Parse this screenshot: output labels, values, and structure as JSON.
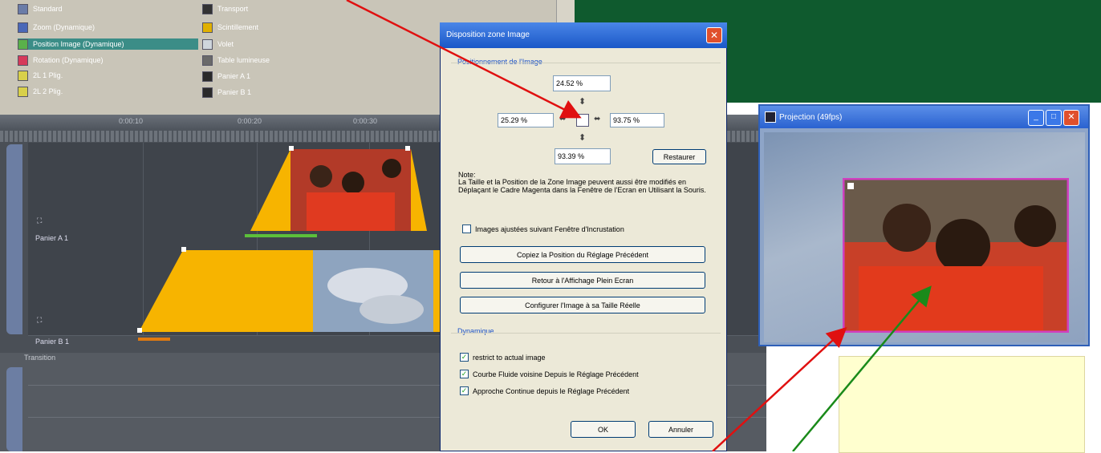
{
  "effects": {
    "left_column": [
      {
        "label": "Standard",
        "icon": "standard-icon"
      },
      {
        "label": "Zoom (Dynamique)",
        "icon": "zoom-icon"
      },
      {
        "label": "Position Image (Dynamique)",
        "icon": "position-image-icon",
        "selected": true
      },
      {
        "label": "Rotation (Dynamique)",
        "icon": "rotation-icon"
      },
      {
        "label": "2L 1 Plig.",
        "icon": "fold-icon"
      },
      {
        "label": "2L 2 Plig.",
        "icon": "fold-icon"
      }
    ],
    "right_column": [
      {
        "label": "Transport",
        "icon": "transport-icon"
      },
      {
        "label": "Scintillement",
        "icon": "flicker-icon"
      },
      {
        "label": "Volet",
        "icon": "wipe-icon"
      },
      {
        "label": "Table lumineuse",
        "icon": "lightbox-icon"
      },
      {
        "label": "Panier A 1",
        "icon": "basket-icon"
      },
      {
        "label": "Panier B 1",
        "icon": "basket-icon"
      }
    ]
  },
  "timeline": {
    "ruler_labels": [
      "0:00:10",
      "0:00:20",
      "0:00:30"
    ],
    "track_a_label": "Panier A 1",
    "track_b_label": "Panier B 1",
    "lower_label": "Transition"
  },
  "dialog": {
    "title": "Disposition zone Image",
    "group_position": "Positionnement de l'Image",
    "top_value": "24.52 %",
    "left_value": "25.29 %",
    "right_value": "93.75 %",
    "bottom_value": "93.39 %",
    "restore_button": "Restaurer",
    "note_title": "Note:",
    "note_text": "La Taille et la Position de la Zone Image peuvent aussi être modifiés en Déplaçant le Cadre Magenta dans la Fenêtre de l'Ecran en Utilisant la Souris.",
    "checkbox_follow": "Images ajustées suivant Fenêtre d'Incrustation",
    "copy_button": "Copiez la Position du Réglage Précédent",
    "fullscreen_button": "Retour à l'Affichage Plein Ecran",
    "realsize_button": "Configurer l'Image à sa Taille Réelle",
    "group_dynamic": "Dynamique",
    "dyn_restrict": "restrict to actual image",
    "dyn_curve": "Courbe Fluide voisine Depuis le Réglage Précédent",
    "dyn_approach": "Approche Continue depuis le Réglage Précédent",
    "ok_button": "OK",
    "cancel_button": "Annuler"
  },
  "projection": {
    "title": "Projection (49fps)"
  },
  "colors": {
    "arrow_red": "#e01010",
    "arrow_green": "#1a8a1a",
    "image_frame": "#d040c0",
    "keyframe_yellow": "#f7b400",
    "selection_teal": "#3b8d87"
  }
}
